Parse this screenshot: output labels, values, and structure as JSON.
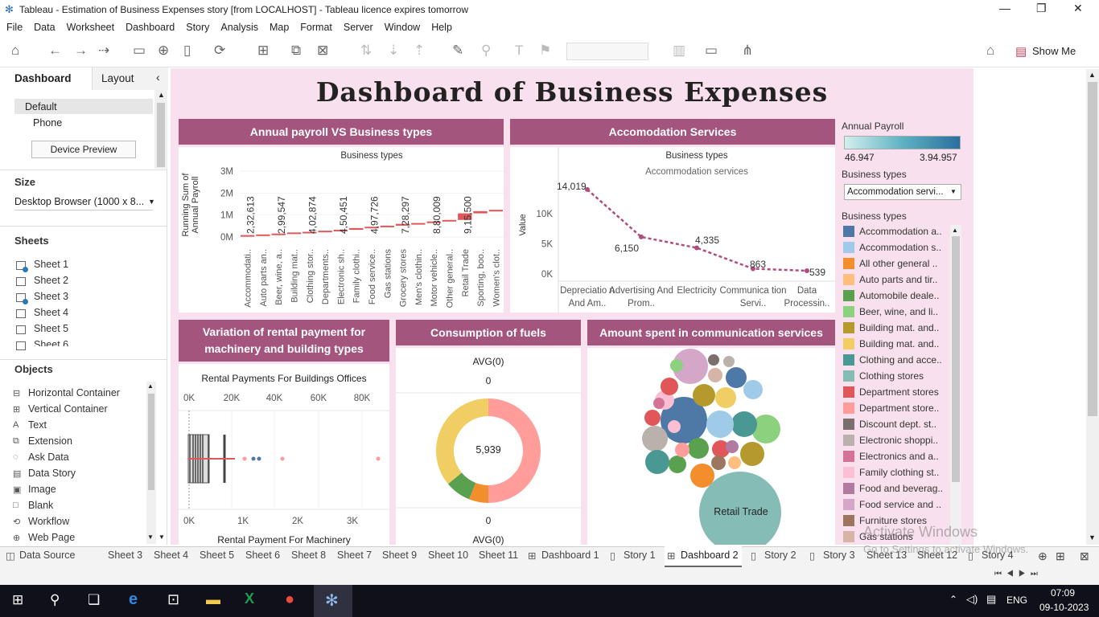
{
  "window": {
    "title": "Tableau - Estimation of Business Expenses story [from LOCALHOST] - Tableau licence expires tomorrow"
  },
  "menu": [
    "File",
    "Data",
    "Worksheet",
    "Dashboard",
    "Story",
    "Analysis",
    "Map",
    "Format",
    "Server",
    "Window",
    "Help"
  ],
  "toolbar": {
    "show_me": "Show Me"
  },
  "left": {
    "tab_dashboard": "Dashboard",
    "tab_layout": "Layout",
    "default": "Default",
    "phone": "Phone",
    "device_preview": "Device Preview",
    "size_h": "Size",
    "size_val": "Desktop Browser (1000 x 8...",
    "sheets_h": "Sheets",
    "sheets": [
      "Sheet 1",
      "Sheet 2",
      "Sheet 3",
      "Sheet 4",
      "Sheet 5",
      "Sheet 6"
    ],
    "objects_h": "Objects",
    "objects": [
      {
        "icon": "⊟",
        "label": "Horizontal Container"
      },
      {
        "icon": "⊞",
        "label": "Vertical Container"
      },
      {
        "icon": "A",
        "label": "Text"
      },
      {
        "icon": "⧉",
        "label": "Extension"
      },
      {
        "icon": "◌",
        "label": "Ask Data"
      },
      {
        "icon": "▤",
        "label": "Data Story"
      },
      {
        "icon": "▣",
        "label": "Image"
      },
      {
        "icon": "□",
        "label": "Blank"
      },
      {
        "icon": "⟲",
        "label": "Workflow"
      },
      {
        "icon": "⊕",
        "label": "Web Page"
      }
    ]
  },
  "dashboard": {
    "title": "Dashboard of Business Expenses",
    "p1": {
      "title": "Annual payroll VS Business types",
      "sub": "Business types",
      "ylabel": "Running Sum of Annual Payroll",
      "ticks": [
        "3M",
        "2M",
        "1M",
        "0M"
      ],
      "labels": [
        "2,32,613",
        "2,99,547",
        "4,02,874",
        "4,50,451",
        "4,97,726",
        "7,28,297",
        "8,80,009",
        "9,15,500"
      ],
      "cats": [
        "Accommodati..",
        "Auto parts an..",
        "Beer, wine, a..",
        "Building mat..",
        "Clothing stor..",
        "Departments..",
        "Electronic sh..",
        "Family clothi..",
        "Food service..",
        "Gas stations",
        "Grocery stores",
        "Men's clothin..",
        "Motor vehicle..",
        "Other general..",
        "Retail Trade",
        "Sporting, boo..",
        "Women's clot.."
      ]
    },
    "p2": {
      "title": "Accomodation Services",
      "sub": "Business types",
      "sub2": "Accommodation services",
      "ylabel": "Value",
      "ticks": [
        "10K",
        "5K",
        "0K"
      ],
      "labels": [
        "14,019",
        "6,150",
        "4,335",
        "863",
        "539"
      ],
      "cats": [
        "Depreciatio n And Am..",
        "Advertising And Prom..",
        "Electricity",
        "Communica tion Servi..",
        "Data Processin.."
      ]
    },
    "p3": {
      "title": "Variation of rental payment for machinery and building types",
      "top": "Rental Payments For Buildings Offices",
      "xticks_top": [
        "0K",
        "20K",
        "40K",
        "60K",
        "80K"
      ],
      "xticks_bot": [
        "0K",
        "1K",
        "2K",
        "3K"
      ],
      "bottom": "Rental Payment For Machinery"
    },
    "p4": {
      "title": "Consumption of fuels",
      "avg_top": "AVG(0)",
      "zero_top": "0",
      "center": "5,939",
      "zero_bot": "0",
      "avg_bot": "AVG(0)"
    },
    "p5": {
      "title": "Amount spent in communication services",
      "big": "Retail Trade"
    }
  },
  "legend": {
    "annual_h": "Annual Payroll",
    "min": "46.947",
    "max": "3.94.957",
    "filter_h": "Business types",
    "filter_val": "Accommodation servi...",
    "color_h": "Business types",
    "items": [
      {
        "label": "Accommodation a..",
        "color": "#4e79a7"
      },
      {
        "label": "Accommodation s..",
        "color": "#a0cbe8"
      },
      {
        "label": "All other general ..",
        "color": "#f28e2b"
      },
      {
        "label": "Auto parts and tir..",
        "color": "#ffbe7d"
      },
      {
        "label": "Automobile deale..",
        "color": "#59a14f"
      },
      {
        "label": "Beer, wine, and li..",
        "color": "#8cd17d"
      },
      {
        "label": "Building mat. and..",
        "color": "#b6992d"
      },
      {
        "label": "Building mat. and..",
        "color": "#f1ce63"
      },
      {
        "label": "Clothing and acce..",
        "color": "#499894"
      },
      {
        "label": "Clothing stores",
        "color": "#86bcb6"
      },
      {
        "label": "Department stores",
        "color": "#e15759"
      },
      {
        "label": "Department store..",
        "color": "#ff9d9a"
      },
      {
        "label": "Discount dept. st..",
        "color": "#79706e"
      },
      {
        "label": "Electronic shoppi..",
        "color": "#bab0ac"
      },
      {
        "label": "Electronics and a..",
        "color": "#d37295"
      },
      {
        "label": "Family clothing st..",
        "color": "#fabfd2"
      },
      {
        "label": "Food and beverag..",
        "color": "#b07aa1"
      },
      {
        "label": "Food service and ..",
        "color": "#d4a6c8"
      },
      {
        "label": "Furniture stores",
        "color": "#9d7660"
      },
      {
        "label": "Gas stations",
        "color": "#d7b5a6"
      }
    ]
  },
  "tabs": [
    "Data Source",
    "Sheet 3",
    "Sheet 4",
    "Sheet 5",
    "Sheet 6",
    "Sheet 8",
    "Sheet 7",
    "Sheet 9",
    "Sheet 10",
    "Sheet 11",
    "Dashboard 1",
    "Story 1",
    "Dashboard 2",
    "Story 2",
    "Story 3",
    "Sheet 13",
    "Sheet 12",
    "Story 4"
  ],
  "watermark": {
    "line1": "Activate Windows",
    "line2": "Go to Settings to activate Windows."
  },
  "taskbar": {
    "lang": "ENG",
    "time": "07:09",
    "date": "09-10-2023"
  }
}
